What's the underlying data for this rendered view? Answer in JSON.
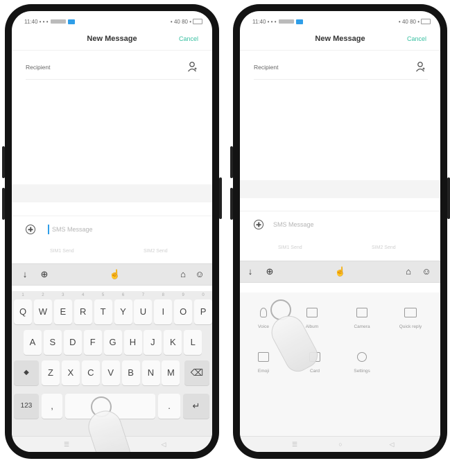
{
  "colors": {
    "accent": "#39c0a2",
    "cursor": "#2f9ee8",
    "frame": "#131313"
  },
  "left": {
    "status": {
      "left_text": "11:40 • • •",
      "right_text": "• 40 80 •"
    },
    "header": {
      "title": "New Message",
      "cancel": "Cancel"
    },
    "recipient_label": "Recipient",
    "sms_placeholder": "SMS Message",
    "sim_hints": [
      "SIM1 Send",
      "SIM2 Send"
    ],
    "keyboard": {
      "row1": [
        "Q",
        "W",
        "E",
        "R",
        "T",
        "Y",
        "U",
        "I",
        "O",
        "P"
      ],
      "row1_hints": [
        "1",
        "2",
        "3",
        "4",
        "5",
        "6",
        "7",
        "8",
        "9",
        "0"
      ],
      "row2": [
        "A",
        "S",
        "D",
        "F",
        "G",
        "H",
        "J",
        "K",
        "L"
      ],
      "row3": [
        "Z",
        "X",
        "C",
        "V",
        "B",
        "N",
        "M"
      ],
      "shift": "◆",
      "backspace": "⌫",
      "symbols": "123",
      "comma": ",",
      "period": ".",
      "enter": "↵"
    }
  },
  "right": {
    "status": {
      "left_text": "11:40 • • •",
      "right_text": "• 40 80 •"
    },
    "header": {
      "title": "New Message",
      "cancel": "Cancel"
    },
    "recipient_label": "Recipient",
    "sms_placeholder": "SMS Message",
    "sim_hints": [
      "SIM1 Send",
      "SIM2 Send"
    ],
    "panel_items": [
      "Voice",
      "Album",
      "Camera",
      "Quick reply",
      "Emoji",
      "Card",
      "Settings"
    ]
  },
  "icons": [
    "mic-icon",
    "globe-icon",
    "gesture-icon",
    "shirt-icon",
    "emoji-icon",
    "person-icon",
    "plus-circle-icon"
  ]
}
